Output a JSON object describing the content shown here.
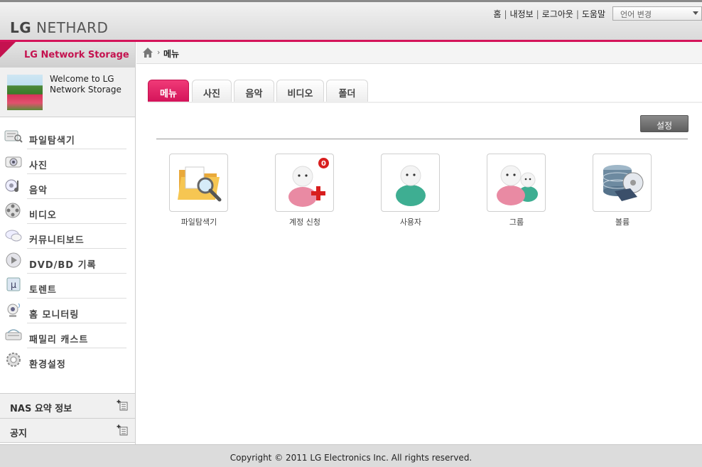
{
  "header": {
    "logo_lg": "LG",
    "logo_brand": "NETHARD",
    "links": [
      "홈",
      "내정보",
      "로그아웃",
      "도움말"
    ],
    "language_select": "언어 변경"
  },
  "sidebar": {
    "title": "LG Network Storage",
    "welcome_text": "Welcome to LG Network Storage",
    "items": [
      {
        "label": "파일탐색기",
        "icon": "file-explorer-icon"
      },
      {
        "label": "사진",
        "icon": "camera-icon"
      },
      {
        "label": "음악",
        "icon": "music-icon"
      },
      {
        "label": "비디오",
        "icon": "video-reel-icon"
      },
      {
        "label": "커뮤니티보드",
        "icon": "community-icon"
      },
      {
        "label": "DVD/BD 기록",
        "icon": "disc-icon"
      },
      {
        "label": "토렌트",
        "icon": "torrent-icon"
      },
      {
        "label": "홈 모니터링",
        "icon": "webcam-icon"
      },
      {
        "label": "패밀리 캐스트",
        "icon": "family-cast-icon"
      },
      {
        "label": "환경설정",
        "icon": "gear-icon"
      }
    ],
    "nas_summary": "NAS 요약 정보",
    "notice": "공지"
  },
  "breadcrumb": {
    "current": "메뉴"
  },
  "tabs": [
    "메뉴",
    "사진",
    "음악",
    "비디오",
    "폴더"
  ],
  "settings_button": "설정",
  "apps": [
    {
      "label": "파일탐색기",
      "icon": "folder-search-icon"
    },
    {
      "label": "계정 신청",
      "icon": "account-request-icon",
      "badge": "0"
    },
    {
      "label": "사용자",
      "icon": "user-icon"
    },
    {
      "label": "그룹",
      "icon": "group-icon"
    },
    {
      "label": "볼륨",
      "icon": "volume-icon"
    }
  ],
  "footer": "Copyright © 2011 LG Electronics Inc. All rights reserved.",
  "colors": {
    "accent": "#d4145a",
    "badge": "#d81e1e"
  }
}
